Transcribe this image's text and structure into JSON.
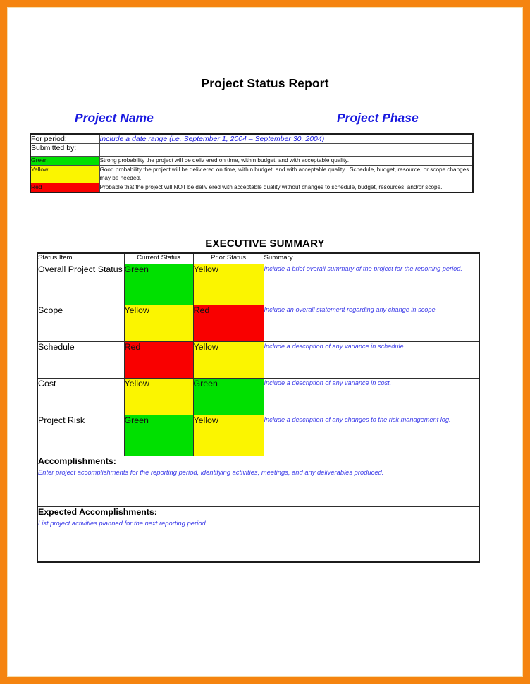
{
  "document": {
    "title": "Project Status Report",
    "project_name_heading": "Project Name",
    "project_phase_heading": "Project Phase",
    "exec_summary_heading": "EXECUTIVE SUMMARY"
  },
  "colors": {
    "page_border": "#f58410",
    "green": "#00e000",
    "yellow": "#fbf500",
    "red": "#f90000",
    "placeholder_text": "#3a3ae8",
    "heading_text": "#1a1ae0"
  },
  "header_table": {
    "for_period_label": "For period:",
    "for_period_value": "Include a date range (i.e. September 1, 2004 – September 30, 2004)",
    "submitted_by_label": "Submitted by:",
    "submitted_by_value": "",
    "legend": [
      {
        "label": "Green",
        "color": "#00e000",
        "description": "Strong probability  the project will be deliv ered on time, within budget, and with acceptable quality."
      },
      {
        "label": "Yellow",
        "color": "#fbf500",
        "description": "Good probability the project will be deliv ered on time, within budget, and with acceptable quality . Schedule, budget, resource, or scope changes may be needed."
      },
      {
        "label": "Red",
        "color": "#f90000",
        "description": "Probable that the project will NOT be deliv ered with acceptable quality without changes to schedule, budget, resources, and/or scope."
      }
    ]
  },
  "exec_summary": {
    "columns": [
      "Status Item",
      "Current Status",
      "Prior Status",
      "Summary"
    ],
    "rows": [
      {
        "item": "Overall Project Status",
        "current_status": "Green",
        "current_color": "#00e000",
        "prior_status": "Yellow",
        "prior_color": "#fbf500",
        "summary": "Include a brief overall summary of the project for the reporting period."
      },
      {
        "item": "Scope",
        "current_status": "Yellow",
        "current_color": "#fbf500",
        "prior_status": "Red",
        "prior_color": "#f90000",
        "summary": "Include an overall statement regarding any change in scope."
      },
      {
        "item": "Schedule",
        "current_status": "Red",
        "current_color": "#f90000",
        "prior_status": "Yellow",
        "prior_color": "#fbf500",
        "summary": "Include a description of any variance in schedule."
      },
      {
        "item": "Cost",
        "current_status": "Yellow",
        "current_color": "#fbf500",
        "prior_status": "Green",
        "prior_color": "#00e000",
        "summary": "Include a description of any variance in cost."
      },
      {
        "item": "Project Risk",
        "current_status": "Green",
        "current_color": "#00e000",
        "prior_status": "Yellow",
        "prior_color": "#fbf500",
        "summary": "Include a description of any changes to the risk management log."
      }
    ]
  },
  "accomplishments": {
    "title": "Accomplishments:",
    "body": "Enter project accomplishments for the reporting period, identifying activities, meetings, and any deliverables produced."
  },
  "expected_accomplishments": {
    "title": "Expected Accomplishments:",
    "body": "List project activities planned for the next reporting period."
  }
}
